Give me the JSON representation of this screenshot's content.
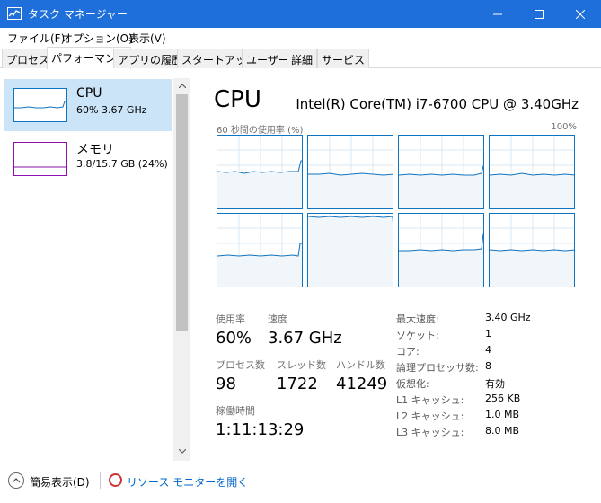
{
  "window": {
    "title": "タスク マネージャー"
  },
  "menu": [
    "ファイル(F)",
    "オプション(O)",
    "表示(V)"
  ],
  "tabs": [
    "プロセス",
    "パフォーマンス",
    "アプリの履歴",
    "スタートアップ",
    "ユーザー",
    "詳細",
    "サービス"
  ],
  "active_tab": "パフォーマンス",
  "sidebar": {
    "items": [
      {
        "title": "CPU",
        "subtitle": "60%  3.67 GHz"
      },
      {
        "title": "メモリ",
        "subtitle": "3.8/15.7 GB (24%)"
      }
    ]
  },
  "cpu": {
    "title": "CPU",
    "model": "Intel(R) Core(TM) i7-6700 CPU @ 3.40GHz",
    "graph_label": "60 秒間の使用率 (%)",
    "graph_max": "100%",
    "stats": {
      "usage_label": "使用率",
      "usage_value": "60%",
      "speed_label": "速度",
      "speed_value": "3.67 GHz",
      "processes_label": "プロセス数",
      "processes_value": "98",
      "threads_label": "スレッド数",
      "threads_value": "1722",
      "handles_label": "ハンドル数",
      "handles_value": "41249",
      "uptime_label": "稼働時間",
      "uptime_value": "1:11:13:29"
    },
    "details": [
      {
        "label": "最大速度:",
        "value": "3.40 GHz"
      },
      {
        "label": "ソケット:",
        "value": "1"
      },
      {
        "label": "コア:",
        "value": "4"
      },
      {
        "label": "論理プロセッサ数:",
        "value": "8"
      },
      {
        "label": "仮想化:",
        "value": "有効"
      },
      {
        "label": "L1 キャッシュ:",
        "value": "256 KB"
      },
      {
        "label": "L2 キャッシュ:",
        "value": "1.0 MB"
      },
      {
        "label": "L3 キャッシュ:",
        "value": "8.0 MB"
      }
    ]
  },
  "footer": {
    "fewer_details": "簡易表示(D)",
    "resource_monitor": "リソース モニターを開く"
  },
  "colors": {
    "titlebar": "#1e6fd9",
    "cpu_accent": "#1174c1",
    "memory_accent": "#8b12ae",
    "selected": "#cce4f7",
    "link": "#0066cc"
  }
}
